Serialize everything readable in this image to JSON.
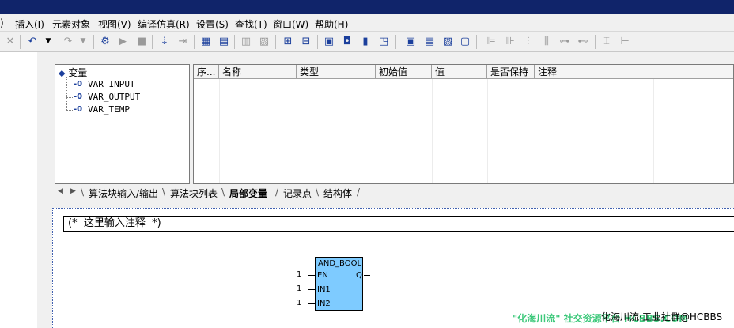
{
  "window": {
    "title": ""
  },
  "menu": [
    "插入(I)",
    "元素对象",
    "视图(V)",
    "编译仿真(R)",
    "设置(S)",
    "查找(T)",
    "窗口(W)",
    "帮助(H)"
  ],
  "toolbar_icons": [
    "close-icon",
    "undo-icon",
    "dropdown-icon",
    "redo-icon",
    "dropdown-icon",
    "run-icon",
    "play-icon",
    "stop-icon",
    "step-icon",
    "step-over-icon",
    "var-table-icon",
    "var-list-icon",
    "table-a-icon",
    "table-b-icon",
    "node-a-icon",
    "node-b-icon",
    "save-icon",
    "config-icon",
    "print-icon",
    "comment-icon",
    "view-a-icon",
    "view-b-icon",
    "view-c-icon",
    "view-d-icon",
    "align-left-icon",
    "align-center-icon",
    "align-right-icon",
    "align-top-icon",
    "link-icon",
    "unlink-icon",
    "space-h-icon",
    "space-v-icon"
  ],
  "tree": {
    "root": "变量",
    "items": [
      "VAR_INPUT",
      "VAR_OUTPUT",
      "VAR_TEMP"
    ]
  },
  "grid": {
    "columns": [
      "序...",
      "名称",
      "类型",
      "初始值",
      "值",
      "是否保持",
      "注释"
    ]
  },
  "tabs": {
    "nav_prev": "◀",
    "nav_next": "▶",
    "items": [
      "算法块输入/输出",
      "算法块列表",
      "局部变量",
      "记录点",
      "结构体"
    ],
    "active": "局部变量"
  },
  "editor": {
    "comment": "(*  这里输入注释  *)",
    "block": {
      "name": "AND_BOOL",
      "inputs": [
        {
          "pin": "EN",
          "value": "1"
        },
        {
          "pin": "IN1",
          "value": "1"
        },
        {
          "pin": "IN2",
          "value": "1"
        }
      ],
      "output": "Q"
    }
  },
  "watermark": {
    "left": "\"化海川流\" 社交资源平台 HCBBS.COM",
    "right": "化海川流·工业社群@HCBBS"
  }
}
